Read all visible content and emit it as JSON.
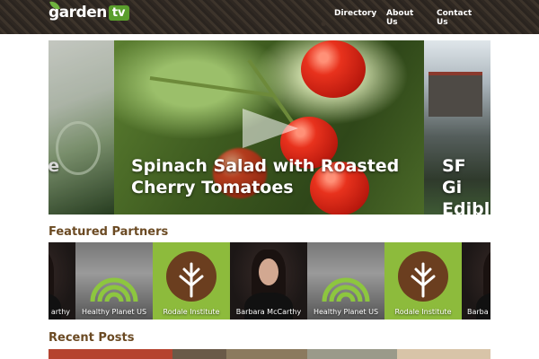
{
  "header": {
    "logo": {
      "word": "garden",
      "badge": "tv"
    },
    "nav": [
      {
        "label": "Directory"
      },
      {
        "label": "About Us"
      },
      {
        "label": "Contact Us"
      }
    ]
  },
  "carousel": {
    "slides": [
      {
        "title": "ce"
      },
      {
        "title": "Spinach Salad with Roasted\nCherry Tomatoes"
      },
      {
        "title": "SF Gi\nEdibl"
      }
    ]
  },
  "featured": {
    "heading": "Featured Partners",
    "partners": [
      {
        "label": "arthy"
      },
      {
        "label": "Healthy Planet US"
      },
      {
        "label": "Rodale Institute"
      },
      {
        "label": "Barbara McCarthy"
      },
      {
        "label": "Healthy Planet US"
      },
      {
        "label": "Rodale Institute"
      },
      {
        "label": "Barba"
      }
    ]
  },
  "recent": {
    "heading": "Recent Posts"
  },
  "colors": {
    "heading_brown": "#6b4a23",
    "logo_green": "#5a9e2c",
    "partner_green": "#8dbb3c"
  }
}
